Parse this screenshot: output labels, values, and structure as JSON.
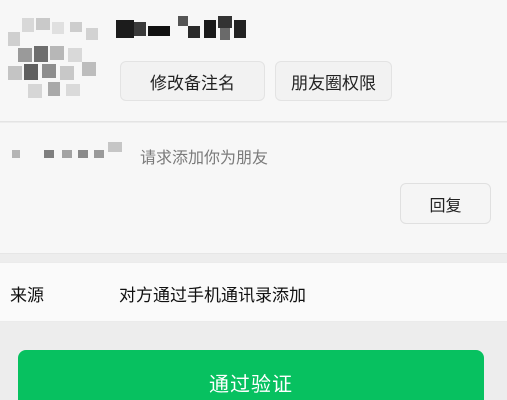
{
  "colors": {
    "accent_green": "#07c160",
    "background": "#ededed",
    "card": "#f7f7f7"
  },
  "profile": {
    "avatar": "pixelated-avatar",
    "name": "pixelated-name",
    "remark_button": "修改备注名",
    "moments_button": "朋友圈权限"
  },
  "request": {
    "sender": "pixelated-sender",
    "text": "请求添加你为朋友",
    "reply_button": "回复"
  },
  "source": {
    "label": "来源",
    "value": "对方通过手机通讯录添加"
  },
  "approve_button": "通过验证"
}
